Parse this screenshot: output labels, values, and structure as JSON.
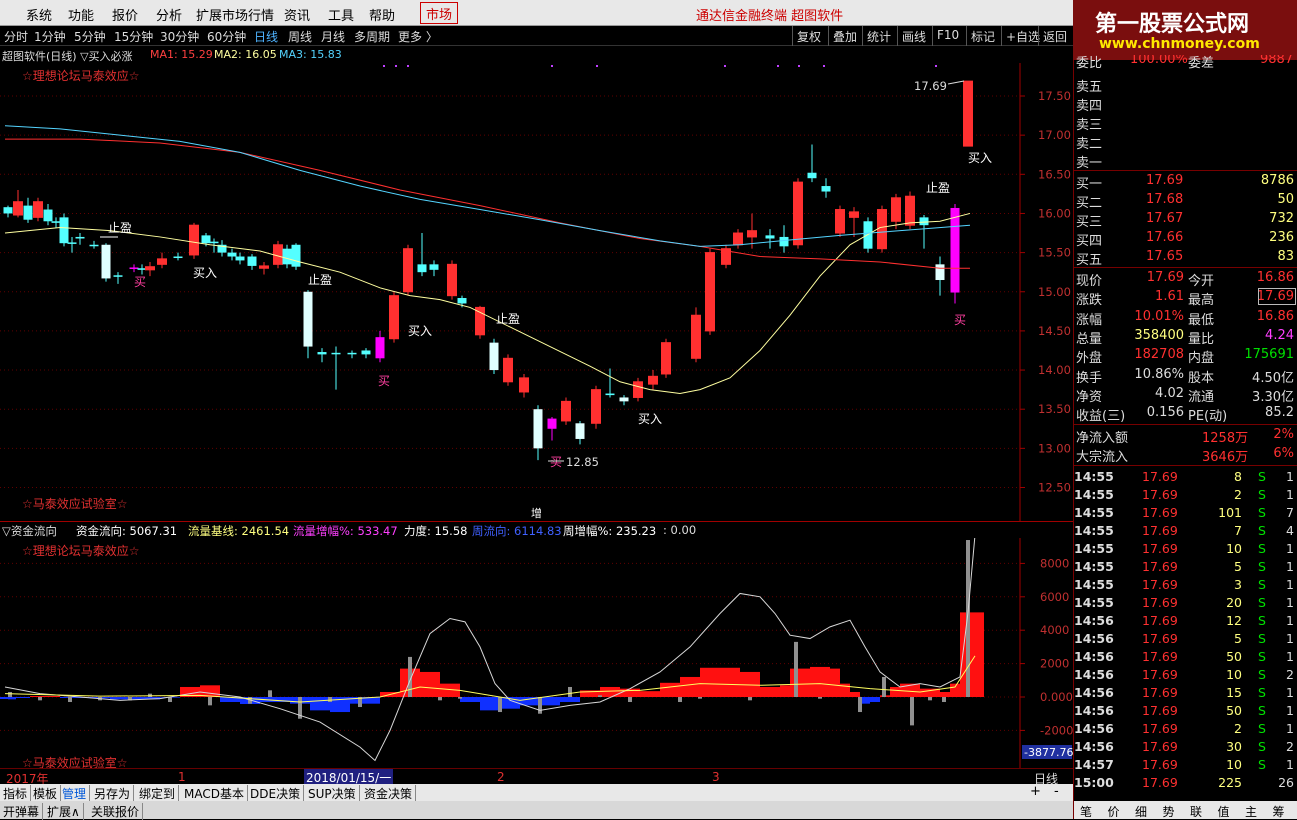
{
  "menu": {
    "items": [
      "系统",
      "功能",
      "报价",
      "分析",
      "扩展市场行情",
      "资讯",
      "工具",
      "帮助"
    ],
    "market": "市场",
    "brand": "通达信金融终端  超图软件"
  },
  "logo": {
    "title": "第一股票公式网",
    "url": "www.chnmoney.com"
  },
  "periods": {
    "items": [
      "分时",
      "1分钟",
      "5分钟",
      "15分钟",
      "30分钟",
      "60分钟",
      "日线",
      "周线",
      "月线",
      "多周期",
      "更多 〉"
    ],
    "active": "日线"
  },
  "toolbar": [
    "复权",
    "叠加",
    "统计",
    "画线",
    "F10",
    "标记",
    "+自选",
    "返回"
  ],
  "status": {
    "name": "超图软件(日线) ▽买入必涨",
    "ma1": "MA1: 15.29",
    "ma2": "MA2: 16.05",
    "ma3": "MA3: 15.83"
  },
  "ribbons": {
    "top1": "☆理想论坛马泰效应☆",
    "top2": "☆马泰效应试验室☆",
    "bot1": "☆理想论坛马泰效应☆",
    "bot2": "☆马泰效应试验室☆"
  },
  "price_axis": [
    "17.50",
    "17.00",
    "16.50",
    "16.00",
    "15.50",
    "15.00",
    "14.50",
    "14.00",
    "13.50",
    "13.00",
    "12.50"
  ],
  "annotations": {
    "high": "17.69",
    "low": "12.85",
    "buy": "买入",
    "stop": "止盈",
    "buy_short": "买",
    "zeng": "增"
  },
  "indicator2": {
    "name": "▽资金流向",
    "flow": "资金流向: 5067.31",
    "base": "流量基线: 2461.54",
    "inc": "流量增幅%: 533.47",
    "force": "力度: 15.58",
    "week": "周流向: 6114.83",
    "weekinc": "周增幅%: 235.23",
    "tail": ": 0.00"
  },
  "ind_axis": [
    "8000",
    "6000",
    "4000",
    "2000",
    "0.000",
    "-2000"
  ],
  "ind_min": "-3877.76",
  "datebar": {
    "year": "2017年",
    "m1": "1",
    "sel": "2018/01/15/一",
    "m2": "2",
    "m3": "3",
    "period": "日线"
  },
  "bottom_tabs": [
    "指标",
    "模板",
    "管理",
    "另存为",
    "绑定到",
    "MACD基本",
    "DDE决策",
    "SUP决策",
    "资金决策"
  ],
  "bottom_tabs2": [
    "开弹幕",
    "扩展∧",
    "关联报价"
  ],
  "orderbook": {
    "header": {
      "l1": "委比",
      "v1": "100.00%",
      "l2": "委差",
      "v2": "9887"
    },
    "sells": [
      "卖五",
      "卖四",
      "卖三",
      "卖二",
      "卖一"
    ],
    "buys": [
      {
        "l": "买一",
        "p": "17.69",
        "v": "8786"
      },
      {
        "l": "买二",
        "p": "17.68",
        "v": "50"
      },
      {
        "l": "买三",
        "p": "17.67",
        "v": "732"
      },
      {
        "l": "买四",
        "p": "17.66",
        "v": "236"
      },
      {
        "l": "买五",
        "p": "17.65",
        "v": "83"
      }
    ]
  },
  "quote": [
    {
      "l1": "现价",
      "v1": "17.69",
      "l2": "今开",
      "v2": "16.86"
    },
    {
      "l1": "涨跌",
      "v1": "1.61",
      "l2": "最高",
      "v2": "17.69"
    },
    {
      "l1": "涨幅",
      "v1": "10.01%",
      "l2": "最低",
      "v2": "16.86"
    },
    {
      "l1": "总量",
      "v1": "358400",
      "l2": "量比",
      "v2": "4.24"
    },
    {
      "l1": "外盘",
      "v1": "182708",
      "l2": "内盘",
      "v2": "175691"
    },
    {
      "l1": "换手",
      "v1": "10.86%",
      "l2": "股本",
      "v2": "4.50亿"
    },
    {
      "l1": "净资",
      "v1": "4.02",
      "l2": "流通",
      "v2": "3.30亿"
    },
    {
      "l1": "收益(三)",
      "v1": "0.156",
      "l2": "PE(动)",
      "v2": "85.2"
    }
  ],
  "flows": [
    {
      "l": "净流入额",
      "v": "1258万",
      "p": "2%"
    },
    {
      "l": "大宗流入",
      "v": "3646万",
      "p": "6%"
    }
  ],
  "ticks": [
    [
      "14:55",
      "17.69",
      "8",
      "S",
      "1"
    ],
    [
      "14:55",
      "17.69",
      "2",
      "S",
      "1"
    ],
    [
      "14:55",
      "17.69",
      "101",
      "S",
      "7"
    ],
    [
      "14:55",
      "17.69",
      "7",
      "S",
      "4"
    ],
    [
      "14:55",
      "17.69",
      "10",
      "S",
      "1"
    ],
    [
      "14:55",
      "17.69",
      "5",
      "S",
      "1"
    ],
    [
      "14:55",
      "17.69",
      "3",
      "S",
      "1"
    ],
    [
      "14:55",
      "17.69",
      "20",
      "S",
      "1"
    ],
    [
      "14:56",
      "17.69",
      "12",
      "S",
      "1"
    ],
    [
      "14:56",
      "17.69",
      "5",
      "S",
      "1"
    ],
    [
      "14:56",
      "17.69",
      "50",
      "S",
      "1"
    ],
    [
      "14:56",
      "17.69",
      "10",
      "S",
      "2"
    ],
    [
      "14:56",
      "17.69",
      "15",
      "S",
      "1"
    ],
    [
      "14:56",
      "17.69",
      "50",
      "S",
      "1"
    ],
    [
      "14:56",
      "17.69",
      "2",
      "S",
      "1"
    ],
    [
      "14:56",
      "17.69",
      "30",
      "S",
      "2"
    ],
    [
      "14:57",
      "17.69",
      "10",
      "S",
      "1"
    ],
    [
      "15:00",
      "17.69",
      "225",
      "",
      "26"
    ]
  ],
  "right_bottom_tabs": [
    "笔",
    "价",
    "细",
    "势",
    "联",
    "值",
    "主",
    "筹"
  ],
  "colors": {
    "up": "#ff3030",
    "down": "#54ffff",
    "magenta": "#ff00ff",
    "yellow": "#ffff00",
    "ma1": "#ffffa0",
    "ma2": "#ff3030",
    "ma3": "#54d4ff"
  }
}
